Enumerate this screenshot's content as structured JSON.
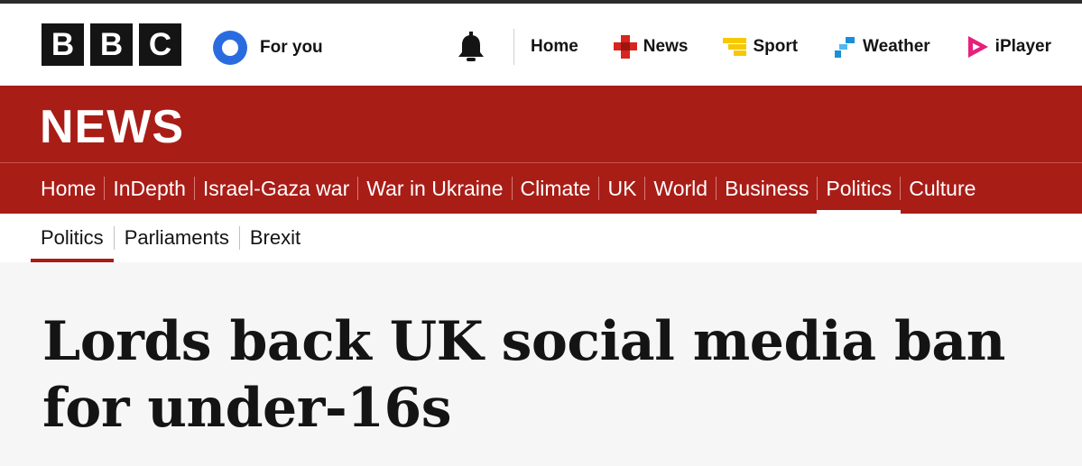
{
  "brand": {
    "letters": [
      "B",
      "B",
      "C"
    ]
  },
  "account": {
    "label": "For you"
  },
  "topnav": {
    "items": [
      {
        "label": "Home",
        "icon": "none"
      },
      {
        "label": "News",
        "icon": "news-icon"
      },
      {
        "label": "Sport",
        "icon": "sport-icon"
      },
      {
        "label": "Weather",
        "icon": "weather-icon"
      },
      {
        "label": "iPlayer",
        "icon": "iplayer-icon"
      }
    ]
  },
  "masthead": {
    "title": "NEWS"
  },
  "mainnav": {
    "items": [
      "Home",
      "InDepth",
      "Israel-Gaza war",
      "War in Ukraine",
      "Climate",
      "UK",
      "World",
      "Business",
      "Politics",
      "Culture"
    ],
    "active": "Politics"
  },
  "subnav": {
    "items": [
      "Politics",
      "Parliaments",
      "Brexit"
    ],
    "active": "Politics"
  },
  "article": {
    "headline": "Lords back UK social media ban for under-16s"
  },
  "colors": {
    "bbc_red": "#a91d17",
    "text_dark": "#141414",
    "page_bg": "#f6f6f6",
    "account_blue": "#2a6ce0",
    "news_red": "#d6261f",
    "sport_yellow": "#f7c900",
    "weather_blue": "#1a8fd6",
    "iplayer_pink": "#e6207b"
  }
}
